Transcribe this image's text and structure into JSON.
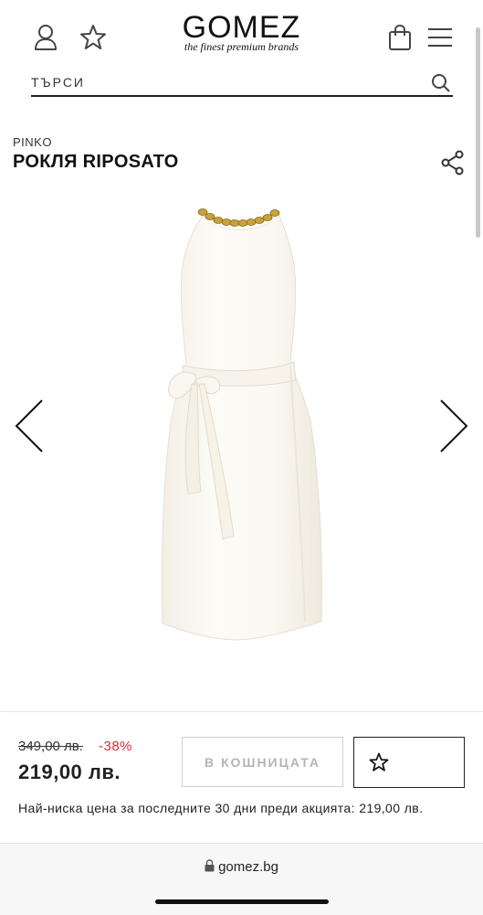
{
  "header": {
    "logo": "GOMEZ",
    "tagline": "the finest premium brands",
    "icons": {
      "account": "user-icon",
      "wishlist": "star-icon",
      "bag": "shopping-bag-icon",
      "menu": "hamburger-menu-icon"
    }
  },
  "search": {
    "placeholder": "ТЪРСИ",
    "icon": "search-icon"
  },
  "product": {
    "brand": "PINKO",
    "name": "РОКЛЯ RIPOSATO",
    "share_icon": "share-icon",
    "gallery": {
      "prev_icon": "chevron-left-icon",
      "next_icon": "chevron-right-icon"
    }
  },
  "purchase": {
    "old_price": "349,00 лв.",
    "discount": "-38%",
    "price": "219,00 лв.",
    "cart_label": "В КОШНИЦАТА",
    "wishlist_icon": "star-icon",
    "lowest_price_note": "Най-ниска цена за последните 30 дни преди акцията: 219,00 лв."
  },
  "browser": {
    "url": "gomez.bg",
    "lock_icon": "lock-icon"
  },
  "colors": {
    "discount": "#d0303a",
    "dress": "#fbf8f1",
    "chain": "#c9a23c"
  }
}
